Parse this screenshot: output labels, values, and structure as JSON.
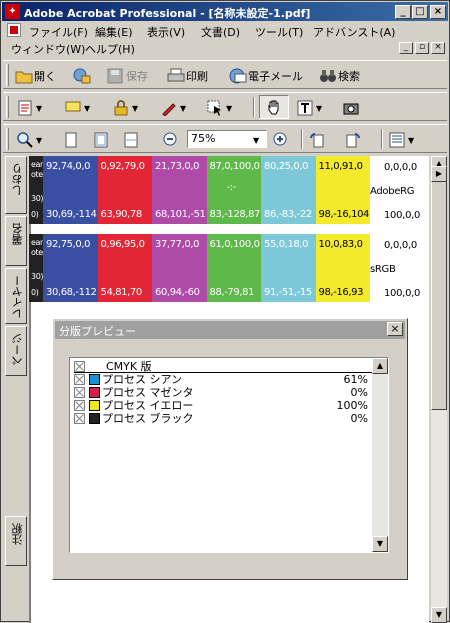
{
  "window": {
    "title": "Adobe Acrobat Professional - [名称未設定-1.pdf]",
    "controls": {
      "minimize": "_",
      "maximize": "□",
      "close": "×"
    }
  },
  "menu": {
    "row1": [
      "ファイル(F)",
      "編集(E)",
      "表示(V)",
      "文書(D)",
      "ツール(T)",
      "アドバンスト(A)"
    ],
    "row2": [
      "ウィンドウ(W)",
      "ヘルプ(H)"
    ]
  },
  "toolbar1": {
    "open": "開く",
    "save": "保存",
    "print": "印刷",
    "email": "電子メール",
    "search": "検索"
  },
  "toolbar3": {
    "zoom": "75%"
  },
  "side_tabs": [
    "しおり",
    "署名",
    "レイヤー",
    "ページ",
    "注釈"
  ],
  "swatch_rows": [
    {
      "left_top": "ean",
      "left_mid": "oted",
      "left_mid2": "30)",
      "left_bot": "0)",
      "cells": [
        {
          "top": "92,74,0,0",
          "bottom": "30,69,-114",
          "color": "#3a4ea2"
        },
        {
          "top": "0,92,79,0",
          "bottom": "63,90,78",
          "color": "#e32636"
        },
        {
          "top": "21,73,0,0",
          "bottom": "68,101,-51",
          "color": "#b04aa8"
        },
        {
          "top": "87,0,100,0",
          "bottom": "83,-128,87",
          "color": "#5fb84a",
          "mark": "-:-"
        },
        {
          "top": "80,25,0,0",
          "bottom": "86,-83,-22",
          "color": "#7dc8d8"
        },
        {
          "top": "11,0,91,0",
          "bottom": "98,-16,104",
          "color": "#f4ea2c"
        }
      ],
      "right_top": "0,0,0,0",
      "right_mid": "AdobeRG",
      "right_bot": "100,0,0"
    },
    {
      "left_top": "ean",
      "left_mid": "oted",
      "left_mid2": "30)",
      "left_bot": "0)",
      "cells": [
        {
          "top": "92,75,0,0",
          "bottom": "30,68,-112",
          "color": "#3a4ea2"
        },
        {
          "top": "0,96,95,0",
          "bottom": "54,81,70",
          "color": "#e32636"
        },
        {
          "top": "37,77,0,0",
          "bottom": "60,94,-60",
          "color": "#b04aa8"
        },
        {
          "top": "61,0,100,0",
          "bottom": "88,-79,81",
          "color": "#5fb84a"
        },
        {
          "top": "55,0,18,0",
          "bottom": "91,-51,-15",
          "color": "#7dc8d8"
        },
        {
          "top": "10,0,83,0",
          "bottom": "98,-16,93",
          "color": "#f4ea2c"
        }
      ],
      "right_top": "0,0,0,0",
      "right_mid": "sRGB",
      "right_bot": "100,0,0"
    }
  ],
  "separation_preview": {
    "title": "分版プレビュー",
    "close": "×",
    "rows": [
      {
        "label": "CMYK 版",
        "value": "",
        "color": ""
      },
      {
        "label": "プロセス シアン",
        "value": "61%",
        "color": "#1a8fd6"
      },
      {
        "label": "プロセス マゼンタ",
        "value": "0%",
        "color": "#d6204e"
      },
      {
        "label": "プロセス イエロー",
        "value": "100%",
        "color": "#f0e818"
      },
      {
        "label": "プロセス ブラック",
        "value": "0%",
        "color": "#222222"
      }
    ]
  }
}
